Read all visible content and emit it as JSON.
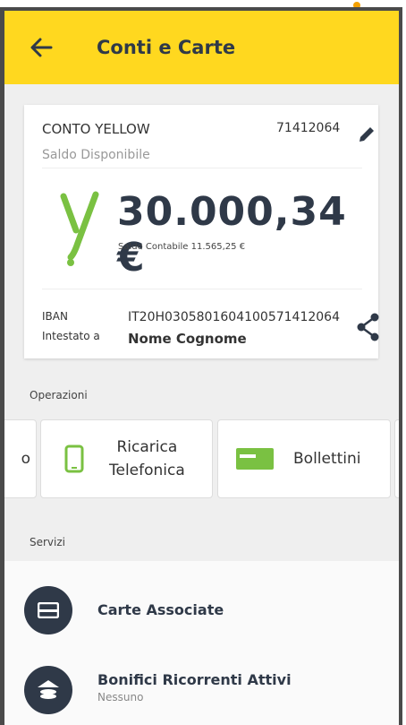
{
  "header": {
    "title": "Conti e Carte"
  },
  "account": {
    "name": "CONTO YELLOW",
    "number": "71412064",
    "balance_caption": "Saldo Disponibile",
    "balance": "30.000,34 €",
    "accounting_balance": "Saldo Contabile 11.565,25 €",
    "iban_label": "IBAN",
    "iban": "IT20H0305801604100571412064",
    "holder_label": "Intestato a",
    "holder": "Nome Cognome"
  },
  "operations": {
    "section_label": "Operazioni",
    "items": [
      {
        "label": "o"
      },
      {
        "label_line1": "Ricarica",
        "label_line2": "Telefonica"
      },
      {
        "label": "Bollettini"
      }
    ]
  },
  "services": {
    "section_label": "Servizi",
    "items": [
      {
        "title": "Carte Associate"
      },
      {
        "title": "Bonifici Ricorrenti Attivi",
        "subtitle": "Nessuno"
      }
    ]
  },
  "colors": {
    "accent": "#ffd81f",
    "dark": "#2f3948",
    "green": "#7ac142"
  }
}
